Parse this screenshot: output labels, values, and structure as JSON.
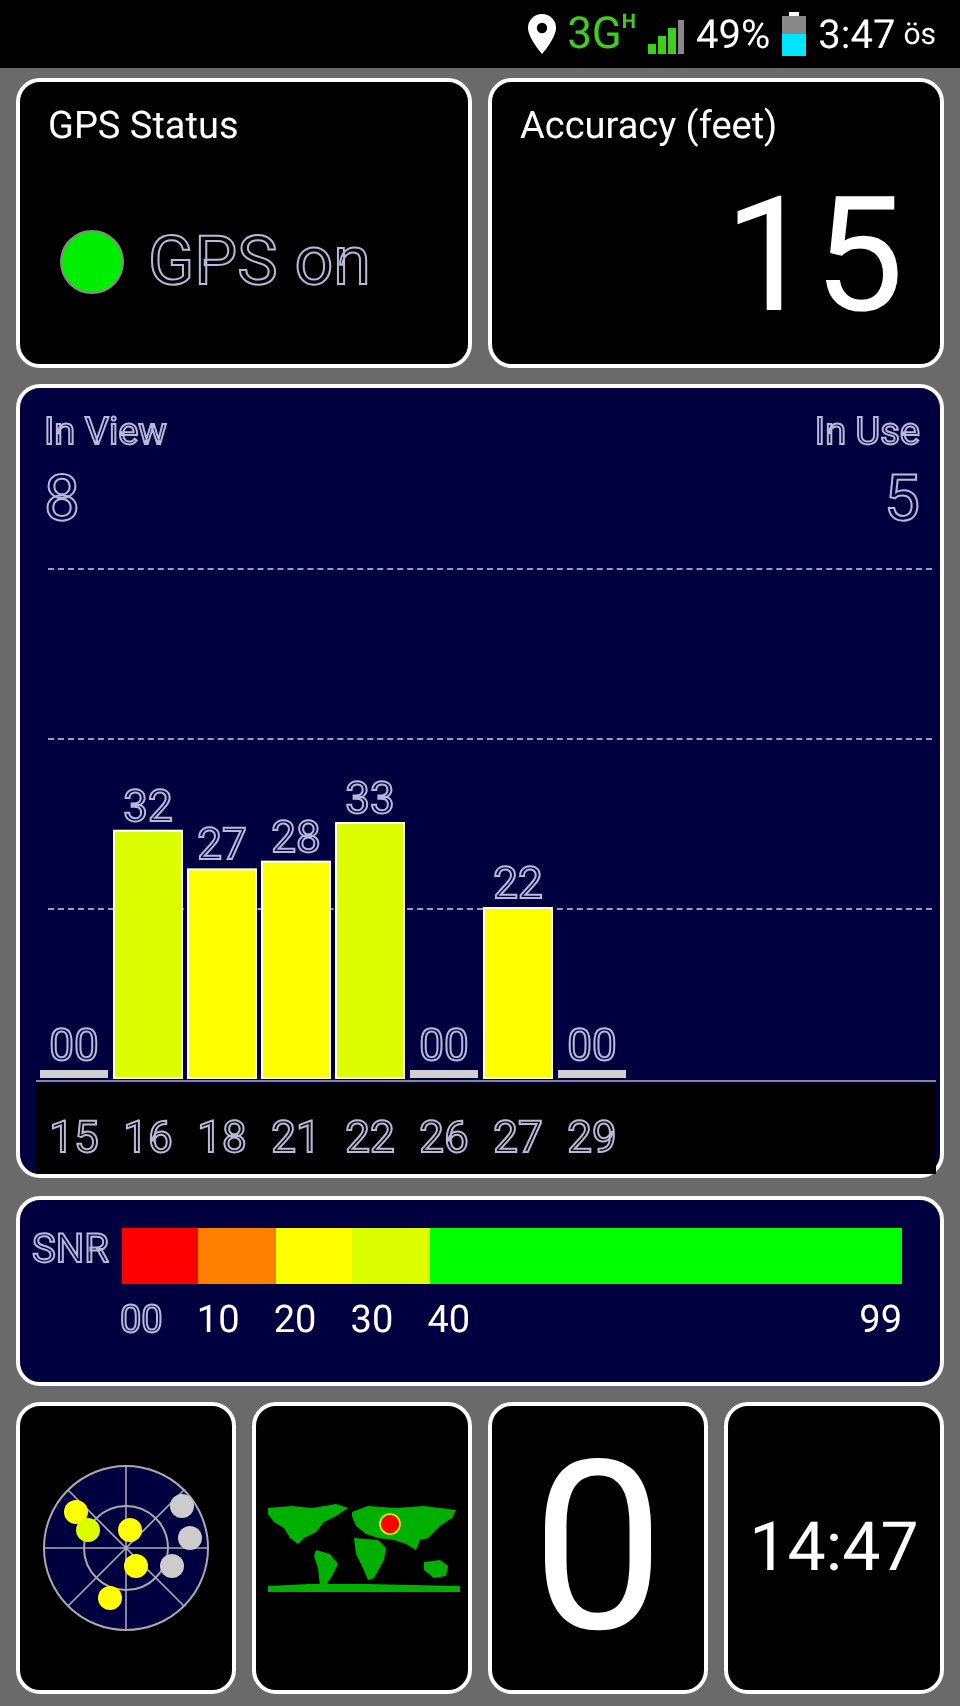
{
  "status_bar": {
    "network": "3G",
    "network_sub": "H",
    "battery": "49%",
    "time": "3:47",
    "ampm": "ös"
  },
  "gps_status": {
    "title": "GPS Status",
    "label": "GPS on",
    "on": true
  },
  "accuracy": {
    "title": "Accuracy (feet)",
    "value": "15"
  },
  "satellites": {
    "in_view_label": "In View",
    "in_view": "8",
    "in_use_label": "In Use",
    "in_use": "5",
    "chart_data": {
      "type": "bar",
      "categories": [
        "15",
        "16",
        "18",
        "21",
        "22",
        "26",
        "27",
        "29"
      ],
      "values": [
        0,
        32,
        27,
        28,
        33,
        0,
        22,
        0
      ],
      "value_labels": [
        "00",
        "32",
        "27",
        "28",
        "33",
        "00",
        "22",
        "00"
      ],
      "colors": [
        "#d0d0d0",
        "#dcff00",
        "#ffff00",
        "#ffff00",
        "#dcff00",
        "#d0d0d0",
        "#ffff00",
        "#d0d0d0"
      ]
    }
  },
  "snr_legend": {
    "label": "SNR",
    "bands": [
      {
        "start": "00",
        "color": "#ff0000"
      },
      {
        "start": "10",
        "color": "#ff8000"
      },
      {
        "start": "20",
        "color": "#ffff00"
      },
      {
        "start": "30",
        "color": "#dcff00"
      },
      {
        "start": "40",
        "color": "#00ff00"
      }
    ],
    "end": "99"
  },
  "tiles": {
    "speed": "0",
    "clock": "14:47"
  }
}
